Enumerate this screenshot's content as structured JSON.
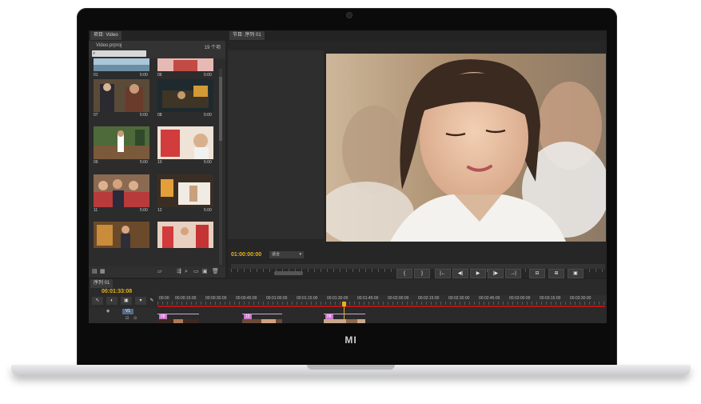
{
  "device": {
    "brand": "MI"
  },
  "project_panel": {
    "tab": "项目: Video",
    "file": "Video.prproj",
    "item_count": "19 个项",
    "items": [
      {
        "label": "01",
        "duration": "5:00"
      },
      {
        "label": "06",
        "duration": "5:00"
      },
      {
        "label": "07",
        "duration": "5:00"
      },
      {
        "label": "08",
        "duration": "5:00"
      },
      {
        "label": "09",
        "duration": "5:00"
      },
      {
        "label": "10",
        "duration": "5:00"
      },
      {
        "label": "11",
        "duration": "5:00"
      },
      {
        "label": "12",
        "duration": "5:00"
      }
    ]
  },
  "program_panel": {
    "tab": "节目: 序列 01",
    "timecode": "01:00:00:00",
    "fit": "适合",
    "transport": [
      "{",
      "}",
      "|←",
      "◀|",
      "▶",
      "|▶",
      "→|",
      "⊟",
      "⊞",
      "▣"
    ]
  },
  "timeline": {
    "tab": "序列 01",
    "timecode": "00:01:33:08",
    "track": "V1",
    "ruler": [
      "00:00",
      "00:00:15:00",
      "00:00:30:00",
      "00:00:45:00",
      "00:01:00:00",
      "00:01:15:00",
      "00:01:30:00",
      "00:01:45:00",
      "00:02:00:00",
      "00:02:15:00",
      "00:02:30:00",
      "00:02:45:00",
      "00:03:00:00",
      "00:03:15:00",
      "00:03:30:00"
    ],
    "clips": [
      "08",
      "15",
      "08"
    ]
  },
  "colors": {
    "accent": "#e8b21e",
    "work_area": "#b41616",
    "clip": "#c878c9"
  }
}
